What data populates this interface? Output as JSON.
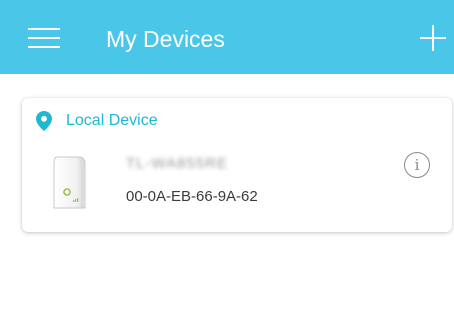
{
  "header": {
    "title": "My Devices",
    "background_color": "#4ac6e8",
    "menu_icon": "hamburger-menu-icon",
    "add_icon": "plus-icon"
  },
  "section": {
    "title": "Local Device",
    "icon": "location-pin-icon",
    "accent_color": "#1fb8d3"
  },
  "devices": [
    {
      "name": "TL-WA855RE",
      "mac": "00-0A-EB-66-9A-62",
      "icon": "range-extender-icon",
      "info_icon": "info-icon"
    }
  ]
}
